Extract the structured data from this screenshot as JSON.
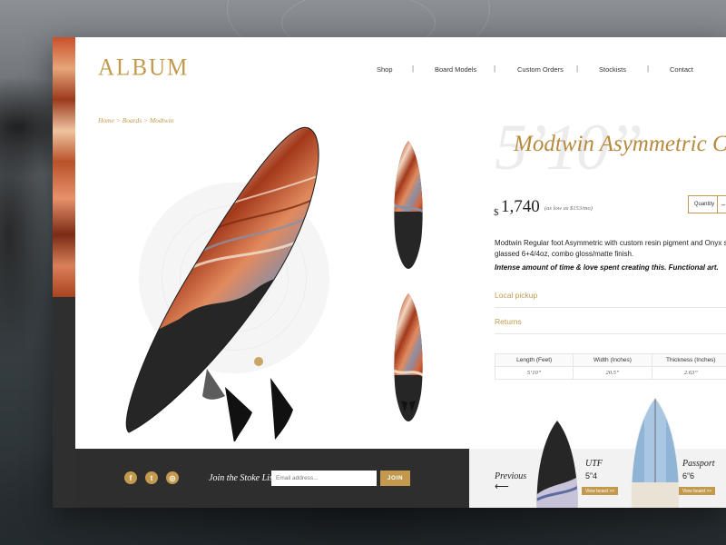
{
  "header": {
    "logo": "ALBUM",
    "nav": [
      {
        "label": "Shop"
      },
      {
        "label": "Board Models"
      },
      {
        "label": "Custom Orders"
      },
      {
        "label": "Stockists"
      },
      {
        "label": "Contact"
      }
    ],
    "nav_separator": "|"
  },
  "breadcrumb": "Home > Boards > Modtwin",
  "product": {
    "size_display": "5’10”",
    "title": "Modtwin Asymmetric C",
    "currency": "$",
    "price": "1,740",
    "price_note": "(as low as $153/mo)",
    "quantity_label": "Quantity",
    "quantity_control": "–",
    "description": [
      "Modtwin Regular foot Asymmetric with custom resin pigment and Onyx s",
      "glassed 6+4/4oz, combo gloss/matte finish."
    ],
    "description_emphasis": "Intense amount of time & love spent creating this. Functional art.",
    "accordions": [
      "Local pickup",
      "Returns"
    ],
    "specs": {
      "headers": [
        "Length (Feet)",
        "Width (Inches)",
        "Thickness (Inches)"
      ],
      "values": [
        "5’10”",
        "20.5”",
        "2.63”"
      ]
    }
  },
  "footer": {
    "social": [
      {
        "icon": "facebook-icon",
        "glyph": "f"
      },
      {
        "icon": "twitter-icon",
        "glyph": "t"
      },
      {
        "icon": "instagram-icon",
        "glyph": "◎"
      }
    ],
    "newsletter_label": "Join the Stoke List",
    "email_placeholder": "Email address...",
    "join_label": "JOIN",
    "previous_label": "Previous",
    "previous_arrow": "⟵",
    "related": [
      {
        "name": "UTF",
        "size": "5”4",
        "button": "View board >>"
      },
      {
        "name": "Passport",
        "size": "6”6",
        "button": "View board >>"
      }
    ]
  },
  "colors": {
    "accent": "#c39a4d",
    "footer_dark": "#2e2e2e",
    "board_dark": "#262626",
    "resin_orange": "#c9502a"
  }
}
